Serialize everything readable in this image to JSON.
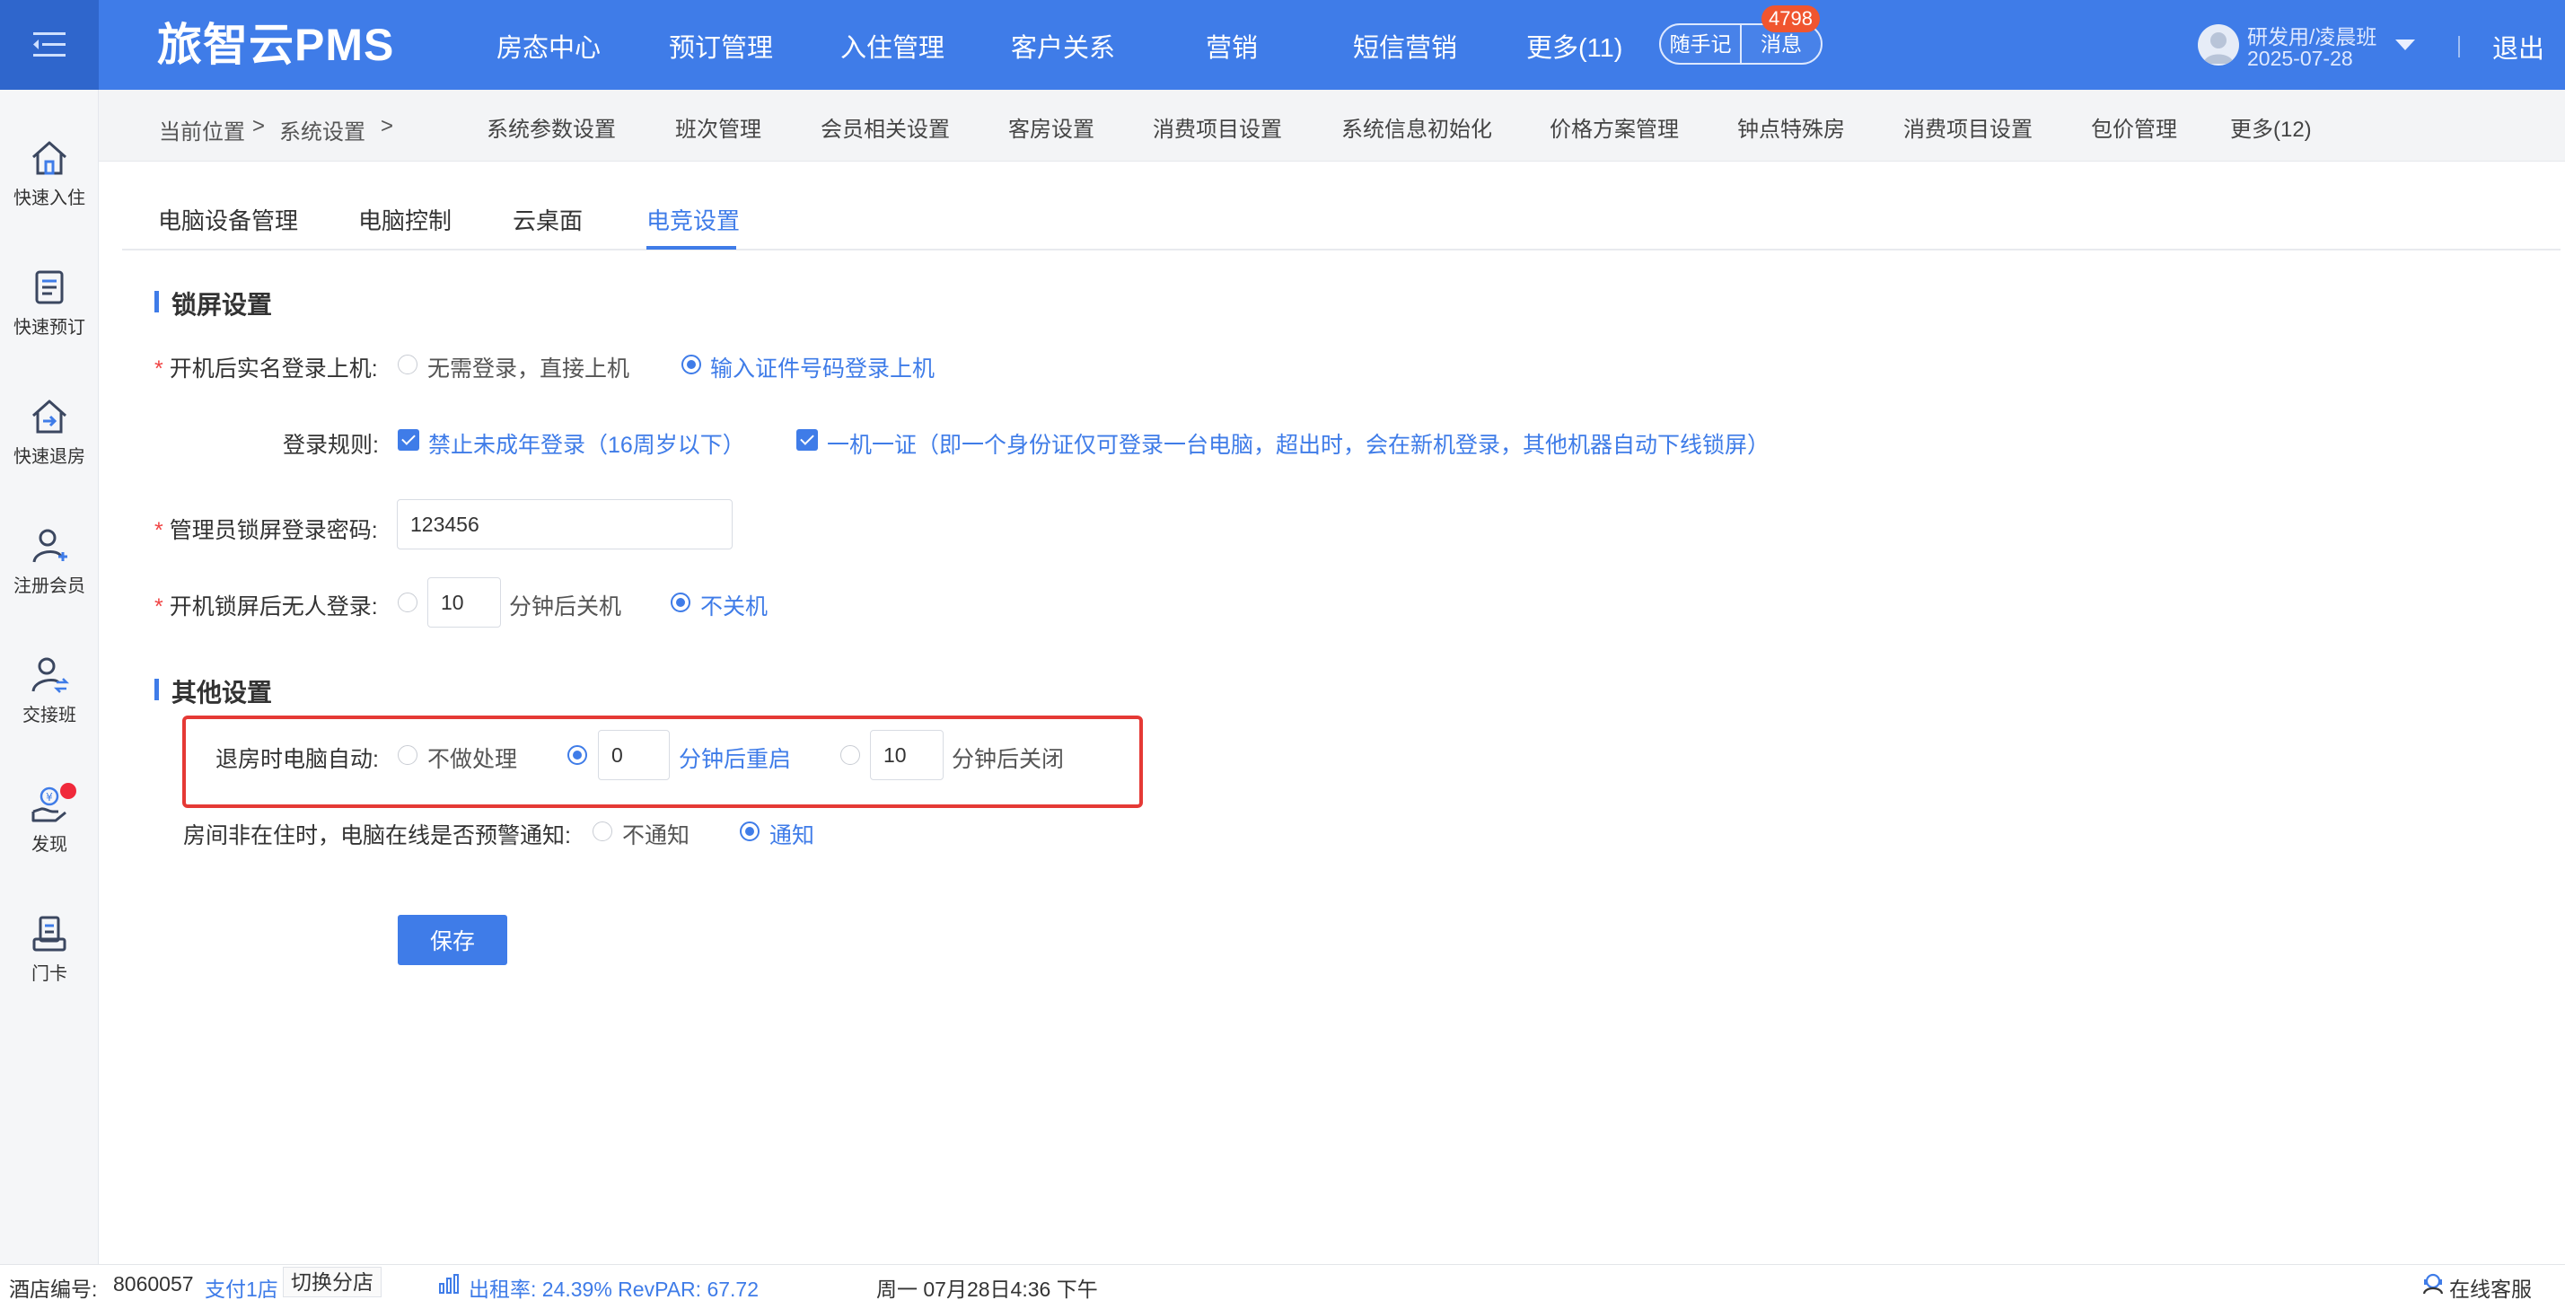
{
  "app": {
    "logo": "旅智云PMS",
    "nav": [
      "房态中心",
      "预订管理",
      "入住管理",
      "客户关系",
      "营销",
      "短信营销",
      "更多(11)"
    ],
    "memo_label": "随手记",
    "message_label": "消息",
    "message_count": "4798",
    "user_name": "研发用/凌晨班",
    "user_date": "2025-07-28",
    "logout": "退出"
  },
  "sidebar": {
    "items": [
      {
        "label": "快速入住",
        "icon": "home-icon"
      },
      {
        "label": "快速预订",
        "icon": "document-list-icon"
      },
      {
        "label": "快速退房",
        "icon": "checkout-house-icon"
      },
      {
        "label": "注册会员",
        "icon": "add-user-icon"
      },
      {
        "label": "交接班",
        "icon": "shift-handover-icon"
      },
      {
        "label": "发现",
        "icon": "discover-hand-coin-icon"
      },
      {
        "label": "门卡",
        "icon": "door-card-icon"
      }
    ]
  },
  "breadcrumb": {
    "current_label": "当前位置",
    "section": "系统设置",
    "separator": ">"
  },
  "subnav": [
    "系统参数设置",
    "班次管理",
    "会员相关设置",
    "客房设置",
    "消费项目设置",
    "系统信息初始化",
    "价格方案管理",
    "钟点特殊房",
    "消费项目设置",
    "包价管理",
    "更多(12)"
  ],
  "tabs": {
    "items": [
      "电脑设备管理",
      "电脑控制",
      "云桌面",
      "电竞设置"
    ],
    "active": "电竞设置"
  },
  "lock_section": {
    "title": "锁屏设置",
    "realname_login": {
      "label": "开机后实名登录上机:",
      "options": [
        "无需登录，直接上机",
        "输入证件号码登录上机"
      ],
      "selected": "输入证件号码登录上机"
    },
    "login_rules": {
      "label": "登录规则:",
      "rule1": "禁止未成年登录（16周岁以下）",
      "rule2": "一机一证（即一个身份证仅可登录一台电脑，超出时，会在新机登录，其他机器自动下线锁屏）"
    },
    "admin_password": {
      "label": "管理员锁屏登录密码:",
      "value": "123456"
    },
    "idle_login": {
      "label": "开机锁屏后无人登录:",
      "minutes": "10",
      "minutes_suffix": "分钟后关机",
      "option_no_shutdown": "不关机",
      "selected": "不关机"
    }
  },
  "other_section": {
    "title": "其他设置",
    "checkout_auto": {
      "label": "退房时电脑自动:",
      "option_none": "不做处理",
      "restart_minutes": "0",
      "restart_suffix": "分钟后重启",
      "shutdown_minutes": "10",
      "shutdown_suffix": "分钟后关闭",
      "selected": "restart"
    },
    "alert_notify": {
      "label": "房间非在住时，电脑在线是否预警通知:",
      "options": [
        "不通知",
        "通知"
      ],
      "selected": "通知"
    }
  },
  "save_button": "保存",
  "status_bar": {
    "hotel_no_label": "酒店编号:",
    "hotel_no": "8060057",
    "store": "支付1店",
    "switch_store": "切换分店",
    "occupancy": "出租率: 24.39% RevPAR: 67.72",
    "datetime": "周一 07月28日4:36 下午",
    "online_service": "在线客服"
  },
  "colors": {
    "primary": "#3f7ce8",
    "highlight_border": "#e53935",
    "badge": "#f0552f"
  }
}
